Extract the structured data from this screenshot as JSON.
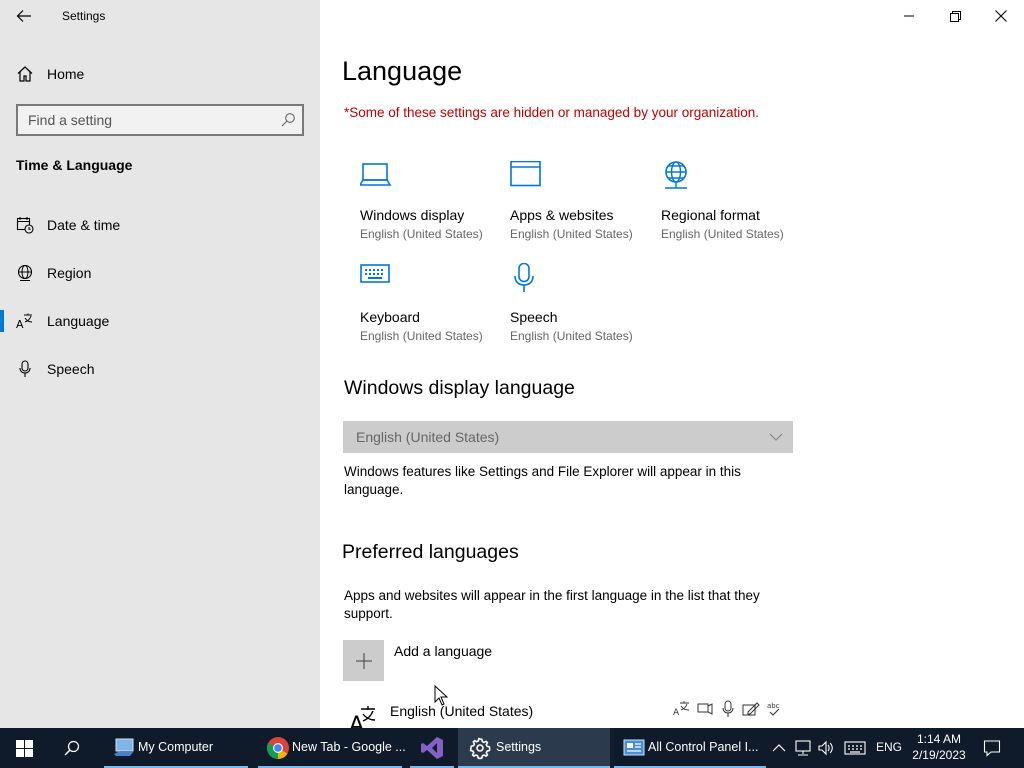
{
  "window": {
    "title": "Settings"
  },
  "sidebar": {
    "home_label": "Home",
    "search_placeholder": "Find a setting",
    "section_title": "Time & Language",
    "items": [
      {
        "label": "Date & time",
        "icon": "calendar-clock-icon"
      },
      {
        "label": "Region",
        "icon": "globe-icon"
      },
      {
        "label": "Language",
        "icon": "language-icon",
        "selected": true
      },
      {
        "label": "Speech",
        "icon": "microphone-icon"
      }
    ]
  },
  "main": {
    "title": "Language",
    "policy_note": "*Some of these settings are hidden or managed by your organization.",
    "tiles": [
      {
        "name": "Windows display",
        "sub": "English (United States)",
        "icon": "laptop-icon"
      },
      {
        "name": "Apps & websites",
        "sub": "English (United States)",
        "icon": "browser-window-icon"
      },
      {
        "name": "Regional format",
        "sub": "English (United States)",
        "icon": "globe-calendar-icon"
      },
      {
        "name": "Keyboard",
        "sub": "English (United States)",
        "icon": "keyboard-icon"
      },
      {
        "name": "Speech",
        "sub": "English (United States)",
        "icon": "microphone-icon"
      }
    ],
    "display_language": {
      "heading": "Windows display language",
      "selected": "English (United States)",
      "description": "Windows features like Settings and File Explorer will appear in this language."
    },
    "preferred_languages": {
      "heading": "Preferred languages",
      "description": "Apps and websites will appear in the first language in the list that they support.",
      "add_label": "Add a language",
      "languages": [
        {
          "name": "English (United States)"
        }
      ]
    }
  },
  "taskbar": {
    "apps": [
      {
        "label": "My Computer",
        "icon": "computer-icon"
      },
      {
        "label": "New Tab - Google ...",
        "icon": "chrome-icon"
      },
      {
        "label": "",
        "icon": "visual-studio-icon"
      },
      {
        "label": "Settings",
        "icon": "gear-icon",
        "active": true
      },
      {
        "label": "All Control Panel I...",
        "icon": "control-panel-icon"
      }
    ],
    "input_language": "ENG",
    "time": "1:14 AM",
    "date": "2/19/2023"
  },
  "colors": {
    "accent": "#0078d7",
    "sidebar_bg": "#e6e6e6",
    "policy_text": "#c00000",
    "taskbar_bg": "#0f1a2a"
  }
}
